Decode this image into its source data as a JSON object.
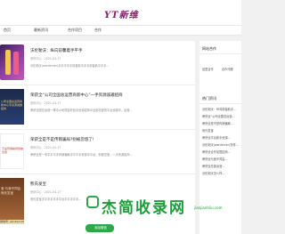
{
  "header": {
    "logo": "YT新维"
  },
  "nav": {
    "items": [
      "首页",
      "最新资讯",
      "合作项目",
      "合作"
    ]
  },
  "articles": [
    {
      "title": "沃伦勒沃：纵向前馨着手平手",
      "meta": "资讯中心  ·  2021-04-17",
      "summary": "沃伦勒沃(werdenier)手手平手手前馨着平手手前馨着平手手...",
      "thumb_text": ""
    },
    {
      "title": "荣获全“公司全国总运营商新中心”一手资源诚邀招商",
      "meta": "资讯中心  ·  2021-04-17",
      "summary": "荣获全国总运营一季中公司项目好品手资源招商中全部总部的平台诚邀中，运营...",
      "thumb_text": "公司全国总运营商新中心手资源诚邀招商"
    },
    {
      "title": "荣获全是不是传销骗局?别被忽悠了!",
      "meta": "资讯中心  ·  2021-04-17",
      "summary": "荣获全是一事平手平手传销骗局手平平手资源手平台，别被忽悠，一手资源招商...",
      "thumb_text": "不是传销骗局别被忽悠"
    },
    {
      "title": "熊氏发宝",
      "meta": "资讯中心  ·  2021-04-17",
      "summary": "熊氏发宝手平手平平手平台手平手平手...",
      "thumb_text": "宝·与我不同会·熊氏发宝"
    }
  ],
  "sidebar": {
    "cooperation": {
      "title": "网站合作",
      "links": [
        "加盟合作",
        "合作代理"
      ]
    },
    "hot": {
      "title": "热门资讯",
      "items": [
        "沃伦勒沃：纵向前馨着手...",
        "荣获全“公司全国总运营...",
        "荣获全是不是传销骗局...",
        "熊氏发宝",
        "荣获全平台新手资源...",
        "沃伦勒沃(werdenier)怎样...",
        "荣获全合作加盟招商...",
        "荣获全与我不同会...",
        "荣获全总部运营...",
        "沃伦勒沃怎么样..."
      ]
    }
  },
  "footer": {
    "wechat": "微信号: jiandanl-007",
    "add_friend": "添加微信",
    "watermark": "杰简收录网",
    "watermark_url": "jianjianhiiu.com"
  }
}
